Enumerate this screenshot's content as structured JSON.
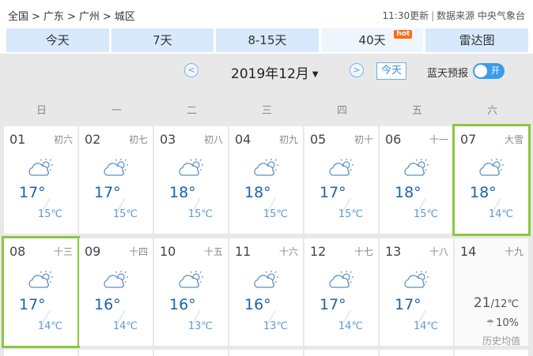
{
  "breadcrumb": {
    "items": [
      "全国",
      "广东",
      "广州",
      "城区"
    ],
    "sep": ">"
  },
  "update": {
    "time": "11:30更新",
    "source": "数据来源 中央气象台"
  },
  "tabs": [
    {
      "label": "今天",
      "active": false
    },
    {
      "label": "7天",
      "active": false
    },
    {
      "label": "8-15天",
      "active": false
    },
    {
      "label": "40天",
      "active": true,
      "badge": "hot"
    },
    {
      "label": "雷达图",
      "active": false
    }
  ],
  "nav": {
    "prev": "<",
    "next": ">",
    "month": "2019年12月",
    "caret": "▼",
    "today": "今天",
    "radar_label": "蓝天预报",
    "radar_toggle": "开"
  },
  "weekdays": [
    "日",
    "一",
    "二",
    "三",
    "四",
    "五",
    "六"
  ],
  "days": [
    {
      "day": "01",
      "lunar": "初六",
      "hi": "17°",
      "lo": "15℃",
      "icon": "partly-cloudy-icon"
    },
    {
      "day": "02",
      "lunar": "初七",
      "hi": "17°",
      "lo": "15℃",
      "icon": "partly-cloudy-icon"
    },
    {
      "day": "03",
      "lunar": "初八",
      "hi": "18°",
      "lo": "15℃",
      "icon": "partly-cloudy-icon"
    },
    {
      "day": "04",
      "lunar": "初九",
      "hi": "18°",
      "lo": "15℃",
      "icon": "partly-cloudy-icon"
    },
    {
      "day": "05",
      "lunar": "初十",
      "hi": "17°",
      "lo": "15℃",
      "icon": "partly-cloudy-icon"
    },
    {
      "day": "06",
      "lunar": "十一",
      "hi": "18°",
      "lo": "15℃",
      "icon": "partly-cloudy-icon"
    },
    {
      "day": "07",
      "lunar": "大雪",
      "hi": "18°",
      "lo": "14℃",
      "icon": "partly-cloudy-icon",
      "selected": true
    },
    {
      "day": "08",
      "lunar": "十三",
      "hi": "17°",
      "lo": "14℃",
      "icon": "partly-cloudy-icon",
      "selected": true
    },
    {
      "day": "09",
      "lunar": "十四",
      "hi": "16°",
      "lo": "14℃",
      "icon": "partly-cloudy-icon"
    },
    {
      "day": "10",
      "lunar": "十五",
      "hi": "16°",
      "lo": "13℃",
      "icon": "partly-cloudy-icon"
    },
    {
      "day": "11",
      "lunar": "十六",
      "hi": "16°",
      "lo": "13℃",
      "icon": "partly-cloudy-icon"
    },
    {
      "day": "12",
      "lunar": "十七",
      "hi": "17°",
      "lo": "14℃",
      "icon": "partly-cloudy-icon"
    },
    {
      "day": "13",
      "lunar": "十八",
      "hi": "17°",
      "lo": "14℃",
      "icon": "partly-cloudy-icon"
    },
    {
      "day": "14",
      "lunar": "十九",
      "history": true,
      "avg_hi": "21",
      "avg_lo": "/12℃",
      "rain": "10%",
      "label": "历史均值"
    }
  ]
}
